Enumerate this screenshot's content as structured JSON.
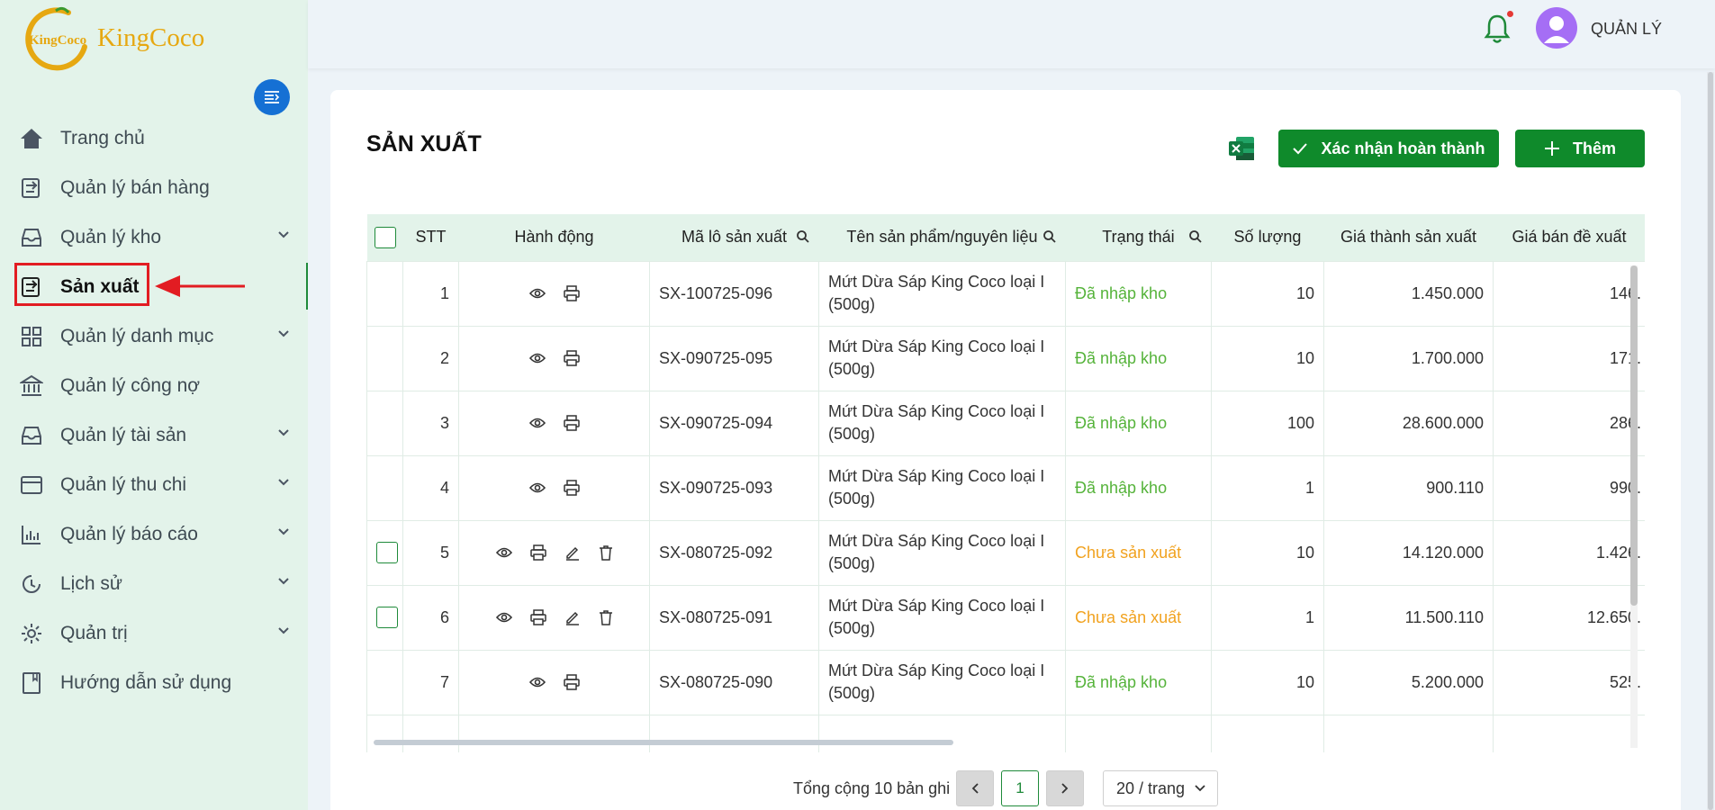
{
  "brand": {
    "logo_text": "KingCoco",
    "logo_mark": "KingCoco"
  },
  "sidebar": {
    "items": [
      {
        "label": "Trang chủ",
        "icon": "home-icon",
        "chevron": false
      },
      {
        "label": "Quản lý bán hàng",
        "icon": "sales-icon",
        "chevron": false
      },
      {
        "label": "Quản lý kho",
        "icon": "inbox-icon",
        "chevron": true
      },
      {
        "label": "Sản xuất",
        "icon": "production-icon",
        "chevron": false,
        "active": true
      },
      {
        "label": "Quản lý danh mục",
        "icon": "grid-icon",
        "chevron": true
      },
      {
        "label": "Quản lý công nợ",
        "icon": "bank-icon",
        "chevron": false
      },
      {
        "label": "Quản lý tài sản",
        "icon": "inbox-icon",
        "chevron": true
      },
      {
        "label": "Quản lý thu chi",
        "icon": "wallet-icon",
        "chevron": true
      },
      {
        "label": "Quản lý báo cáo",
        "icon": "bar-chart-icon",
        "chevron": true
      },
      {
        "label": "Lịch sử",
        "icon": "history-icon",
        "chevron": true
      },
      {
        "label": "Quản trị",
        "icon": "gear-icon",
        "chevron": true
      },
      {
        "label": "Hướng dẫn sử dụng",
        "icon": "book-icon",
        "chevron": false
      }
    ]
  },
  "header": {
    "user_name": "QUẢN LÝ",
    "has_notification": true
  },
  "page": {
    "title": "SẢN XUẤT",
    "confirm_label": "Xác nhận hoàn thành",
    "add_label": "Thêm"
  },
  "table": {
    "columns": [
      "STT",
      "Hành động",
      "Mã lô sản xuất",
      "Tên sản phẩm/nguyên liệu",
      "Trạng thái",
      "Số lượng",
      "Giá thành sản xuất",
      "Giá bán đề xuất"
    ],
    "rows": [
      {
        "stt": "1",
        "code": "SX-100725-096",
        "name": "Mứt Dừa Sáp King Coco loại I (500g)",
        "status": "Đã nhập kho",
        "qty": "10",
        "cost": "1.450.000",
        "price": "146.",
        "editable": false
      },
      {
        "stt": "2",
        "code": "SX-090725-095",
        "name": "Mứt Dừa Sáp King Coco loại I (500g)",
        "status": "Đã nhập kho",
        "qty": "10",
        "cost": "1.700.000",
        "price": "171.",
        "editable": false
      },
      {
        "stt": "3",
        "code": "SX-090725-094",
        "name": "Mứt Dừa Sáp King Coco loại I (500g)",
        "status": "Đã nhập kho",
        "qty": "100",
        "cost": "28.600.000",
        "price": "286.",
        "editable": false
      },
      {
        "stt": "4",
        "code": "SX-090725-093",
        "name": "Mứt Dừa Sáp King Coco loại I (500g)",
        "status": "Đã nhập kho",
        "qty": "1",
        "cost": "900.110",
        "price": "990.",
        "editable": false
      },
      {
        "stt": "5",
        "code": "SX-080725-092",
        "name": "Mứt Dừa Sáp King Coco loại I (500g)",
        "status": "Chưa sản xuất",
        "qty": "10",
        "cost": "14.120.000",
        "price": "1.426.",
        "editable": true
      },
      {
        "stt": "6",
        "code": "SX-080725-091",
        "name": "Mứt Dừa Sáp King Coco loại I (500g)",
        "status": "Chưa sản xuất",
        "qty": "1",
        "cost": "11.500.110",
        "price": "12.650.",
        "editable": true
      },
      {
        "stt": "7",
        "code": "SX-080725-090",
        "name": "Mứt Dừa Sáp King Coco loại I (500g)",
        "status": "Đã nhập kho",
        "qty": "10",
        "cost": "5.200.000",
        "price": "525.",
        "editable": false
      }
    ]
  },
  "pagination": {
    "total": "Tổng cộng 10 bản ghi",
    "current": "1",
    "page_size": "20 / trang"
  },
  "colors": {
    "primary": "#0f8a2b",
    "sidebar_bg": "#e3f3ea",
    "status_done": "#55b33a",
    "status_pending": "#f1a21f",
    "highlight": "#e21c22"
  }
}
